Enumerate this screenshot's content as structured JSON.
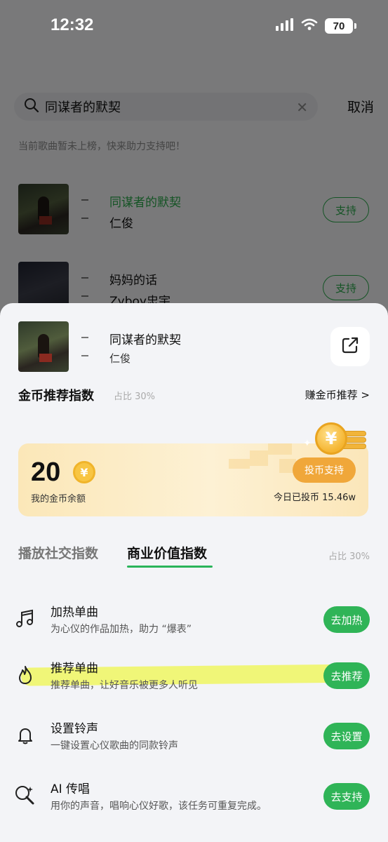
{
  "status_bar": {
    "time": "12:32",
    "battery": "70"
  },
  "search": {
    "query": "同谋者的默契",
    "cancel_label": "取消"
  },
  "notice": "当前歌曲暂未上榜，快来助力支持吧！",
  "song_list": [
    {
      "title": "同谋者的默契",
      "artist": "仁俊",
      "button": "支持",
      "title_color": "#2aa84a"
    },
    {
      "title": "妈妈的话",
      "artist": "Zyboy忠宇",
      "button": "支持"
    }
  ],
  "sheet": {
    "song_title": "同谋者的默契",
    "song_artist": "仁俊",
    "share_icon": "share-icon",
    "coin_section": {
      "title": "金币推荐指数",
      "ratio": "占比 30%",
      "earn_link": "赚金币推荐 >"
    },
    "coin_card": {
      "amount": "20",
      "coin_symbol": "¥",
      "balance_label": "我的金币余额",
      "invest_button": "投币支持",
      "today_invested": "今日已投币 15.46w"
    },
    "tabs": [
      {
        "label": "播放社交指数",
        "active": false
      },
      {
        "label": "商业价值指数",
        "active": true
      }
    ],
    "tab_ratio": "占比 30%",
    "tasks": [
      {
        "icon": "music-note-icon",
        "title": "加热单曲",
        "desc": "为心仪的作品加热，助力 “爆表”",
        "button": "去加热"
      },
      {
        "icon": "flame-icon",
        "title": "推荐单曲",
        "desc": "推荐单曲，让好音乐被更多人听见",
        "button": "去推荐"
      },
      {
        "icon": "bell-icon",
        "title": "设置铃声",
        "desc": "一键设置心仪歌曲的同款铃声",
        "button": "去设置"
      },
      {
        "icon": "ai-mic-icon",
        "title": "AI 传唱",
        "desc": "用你的声音，唱响心仪好歌，该任务可重复完成。",
        "button": "去支持"
      }
    ]
  },
  "colors": {
    "accent_green": "#2fb457",
    "coin_orange": "#f0a73a",
    "highlight_yellow": "#eef646"
  }
}
